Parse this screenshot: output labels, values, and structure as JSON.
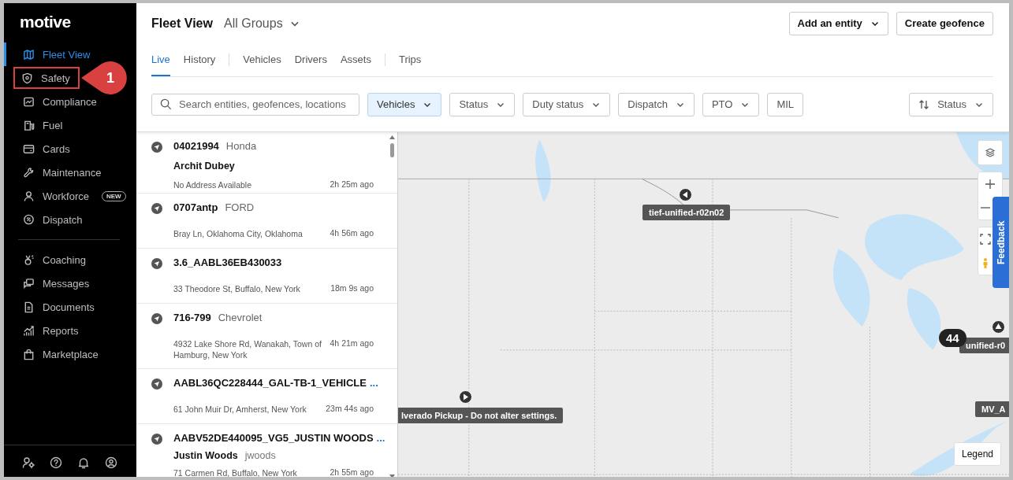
{
  "sidebar": {
    "logo": "motive",
    "nav_groups": [
      [
        {
          "label": "Fleet View",
          "selected": true,
          "annotated": false
        },
        {
          "label": "Safety",
          "selected": false,
          "annotated": true
        },
        {
          "label": "Compliance",
          "selected": false,
          "annotated": false
        },
        {
          "label": "Fuel",
          "selected": false,
          "annotated": false
        },
        {
          "label": "Cards",
          "selected": false,
          "annotated": false
        },
        {
          "label": "Maintenance",
          "selected": false,
          "annotated": false
        },
        {
          "label": "Workforce",
          "selected": false,
          "annotated": false,
          "badge": "NEW"
        },
        {
          "label": "Dispatch",
          "selected": false,
          "annotated": false
        }
      ],
      [
        {
          "label": "Coaching",
          "selected": false,
          "annotated": false
        },
        {
          "label": "Messages",
          "selected": false,
          "annotated": false
        },
        {
          "label": "Documents",
          "selected": false,
          "annotated": false
        },
        {
          "label": "Reports",
          "selected": false,
          "annotated": false
        },
        {
          "label": "Marketplace",
          "selected": false,
          "annotated": false
        }
      ]
    ]
  },
  "annotation": {
    "label": "1"
  },
  "header": {
    "title": "Fleet View",
    "group": "All Groups",
    "buttons": [
      {
        "label": "Add an entity",
        "dropdown": true
      },
      {
        "label": "Create geofence",
        "dropdown": false
      }
    ]
  },
  "tab_groups": [
    [
      {
        "label": "Live",
        "selected": true
      },
      {
        "label": "History",
        "selected": false
      }
    ],
    [
      {
        "label": "Vehicles",
        "selected": false
      },
      {
        "label": "Drivers",
        "selected": false
      },
      {
        "label": "Assets",
        "selected": false
      }
    ],
    [
      {
        "label": "Trips",
        "selected": false
      }
    ]
  ],
  "search": {
    "placeholder": "Search entities, geofences, locations"
  },
  "filters": [
    {
      "label": "Vehicles",
      "dropdown": true,
      "selected": true
    },
    {
      "label": "Status",
      "dropdown": true,
      "selected": false
    },
    {
      "label": "Duty status",
      "dropdown": true,
      "selected": false
    },
    {
      "label": "Dispatch",
      "dropdown": true,
      "selected": false
    },
    {
      "label": "PTO",
      "dropdown": true,
      "selected": false
    },
    {
      "label": "MIL",
      "dropdown": false,
      "selected": false
    }
  ],
  "sort": {
    "label": "Status"
  },
  "vehicles": [
    {
      "name": "04021994",
      "make": "Honda",
      "driver": "Archit Dubey",
      "address": "No Address Available",
      "time": "2h 25m ago"
    },
    {
      "name": "0707antp",
      "make": "FORD",
      "address": "Bray Ln, Oklahoma City, Oklahoma",
      "time": "4h 56m ago"
    },
    {
      "name": "3.6_AABL36EB430033",
      "address": "33 Theodore St, Buffalo, New York",
      "time": "18m 9s ago"
    },
    {
      "name": "716-799",
      "make": "Chevrolet",
      "address": "4932 Lake Shore Rd, Wanakah, Town of Hamburg, New York",
      "time": "4h 21m ago"
    },
    {
      "name": "AABL36QC228444_GAL-TB-1_VEHICLE",
      "more": "...",
      "address": "61 John Muir Dr, Amherst, New York",
      "time": "23m 44s ago"
    },
    {
      "name": "AABV52DE440095_VG5_JUSTIN WOODS",
      "more": "...",
      "driver": "Justin Woods",
      "username": "jwoods",
      "address": "71 Carmen Rd, Buffalo, New York",
      "time": "2h 55m ago"
    }
  ],
  "map": {
    "kind": "picture",
    "vehicle_labels": [
      {
        "label": "tief-unified-r02n02",
        "marker": true
      },
      {
        "label": "lverado Pickup - Do not alter settings.",
        "marker": true
      },
      {
        "label": "unified-r0",
        "marker": true
      },
      {
        "label": "MV_A",
        "marker": false
      }
    ],
    "cluster": "44",
    "legend": "Legend",
    "feedback": "Feedback"
  }
}
